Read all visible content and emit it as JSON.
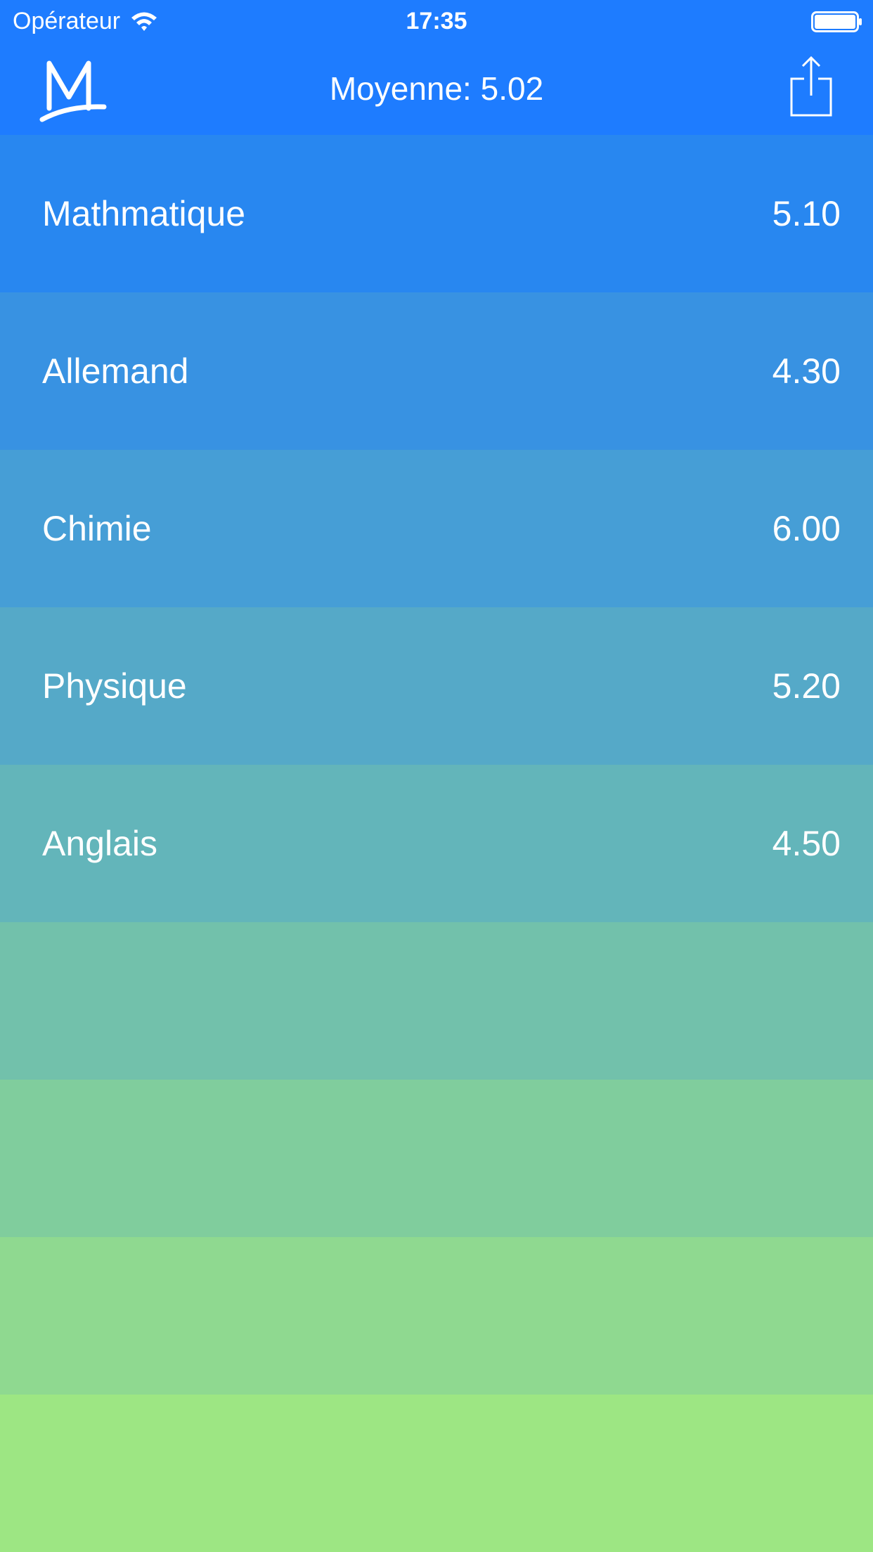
{
  "status_bar": {
    "carrier": "Opérateur",
    "time": "17:35"
  },
  "nav": {
    "title": "Moyenne: 5.02"
  },
  "icons": {
    "logo": "m-logo-icon",
    "share": "share-icon",
    "wifi": "wifi-icon",
    "battery": "battery-icon"
  },
  "subjects": [
    {
      "name": "Mathmatique",
      "grade": "5.10",
      "color": "#2887f0"
    },
    {
      "name": "Allemand",
      "grade": "4.30",
      "color": "#3892e2"
    },
    {
      "name": "Chimie",
      "grade": "6.00",
      "color": "#469ed6"
    },
    {
      "name": "Physique",
      "grade": "5.20",
      "color": "#55a9c8"
    },
    {
      "name": "Anglais",
      "grade": "4.50",
      "color": "#63b5ba"
    },
    {
      "name": "",
      "grade": "",
      "color": "#72c1ab"
    },
    {
      "name": "",
      "grade": "",
      "color": "#80cd9d"
    },
    {
      "name": "",
      "grade": "",
      "color": "#8fd990"
    },
    {
      "name": "",
      "grade": "",
      "color": "#9de683"
    }
  ]
}
